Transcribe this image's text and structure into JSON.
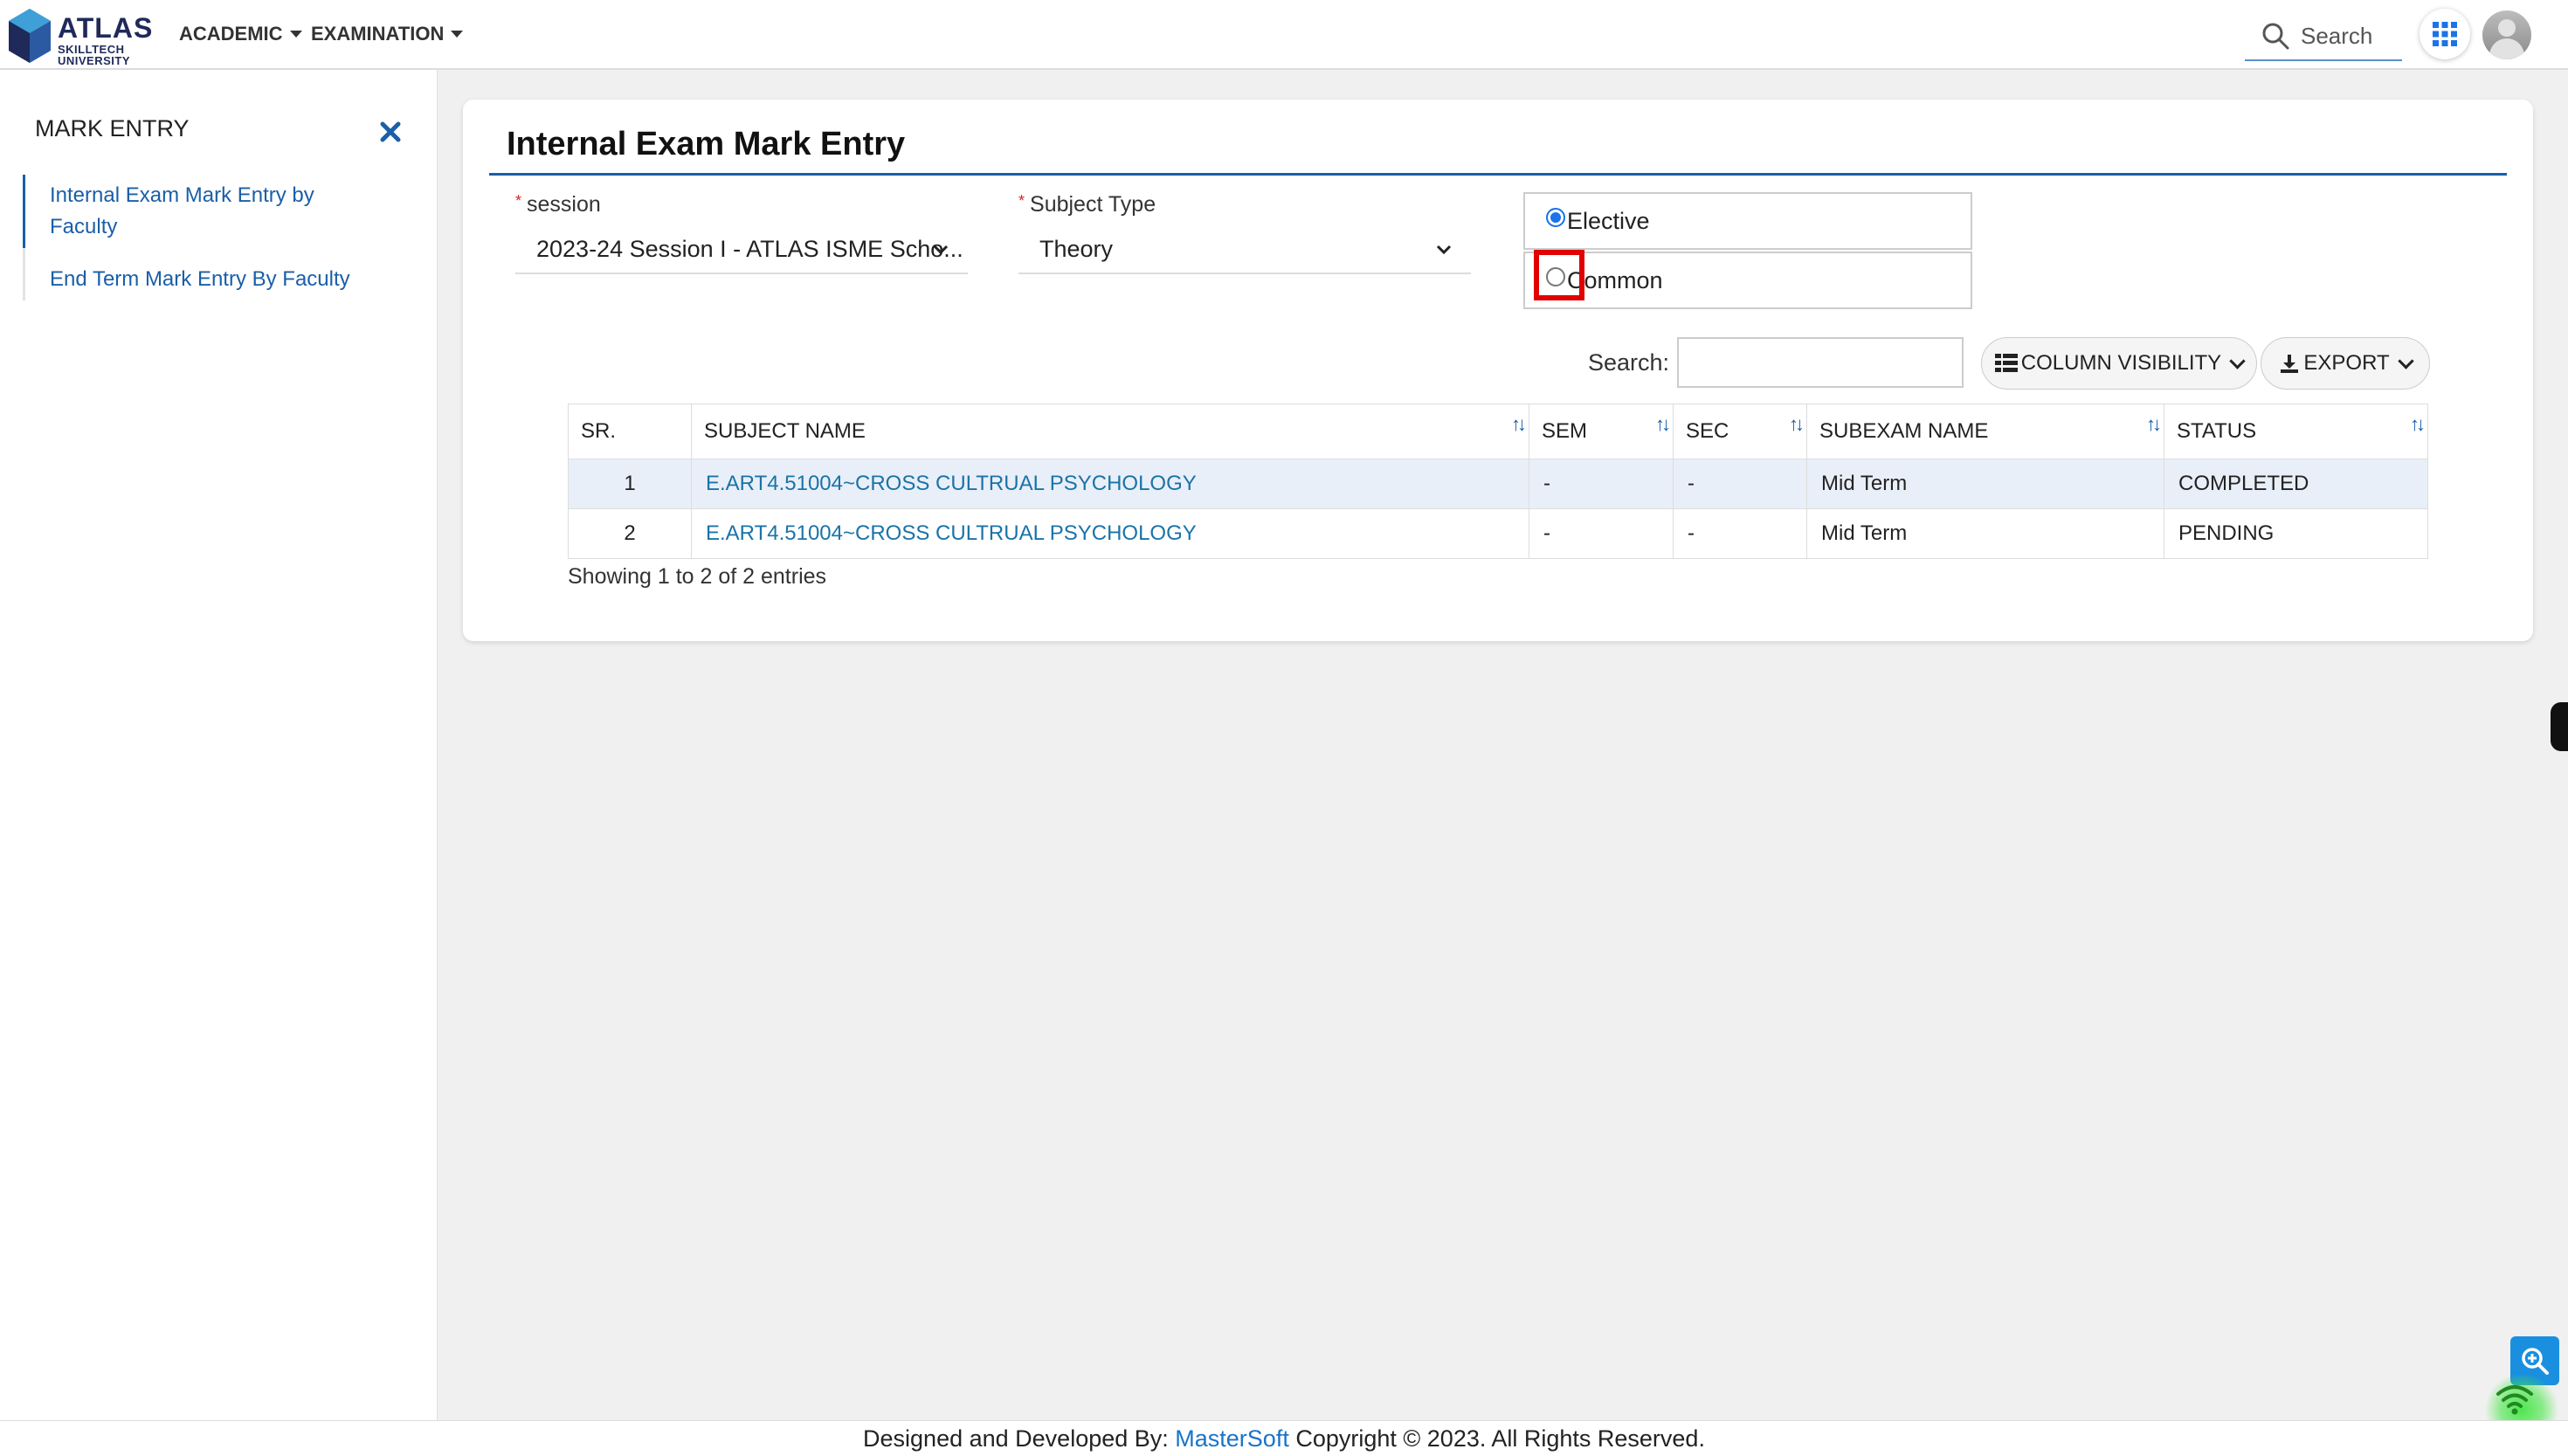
{
  "brand": {
    "name": "ATLAS",
    "subtitle_line1": "SKILLTECH",
    "subtitle_line2": "UNIVERSITY"
  },
  "nav": {
    "menus": [
      {
        "label": "ACADEMIC"
      },
      {
        "label": "EXAMINATION"
      }
    ]
  },
  "header": {
    "search_placeholder": "Search"
  },
  "sidebar": {
    "title": "MARK ENTRY",
    "items": [
      {
        "label": "Internal Exam Mark Entry by",
        "label2": "Faculty",
        "active": true
      },
      {
        "label": "End Term Mark Entry By Faculty",
        "active": false
      }
    ]
  },
  "page": {
    "title": "Internal Exam Mark Entry",
    "session": {
      "label": "session",
      "value": "2023-24 Session I - ATLAS ISME Scho..."
    },
    "subject_type": {
      "label": "Subject Type",
      "value": "Theory"
    },
    "radios": [
      {
        "label": "Elective",
        "checked": true
      },
      {
        "label": "Common",
        "checked": false
      }
    ]
  },
  "table": {
    "search_label": "Search:",
    "column_visibility_label": "COLUMN VISIBILITY",
    "export_label": "EXPORT",
    "columns": [
      "SR.",
      "SUBJECT NAME",
      "SEM",
      "SEC",
      "SUBEXAM NAME",
      "STATUS"
    ],
    "rows": [
      {
        "sr": "1",
        "subject": "E.ART4.51004~CROSS CULTRUAL PSYCHOLOGY",
        "sem": "-",
        "sec": "-",
        "subexam": "Mid Term",
        "status": "COMPLETED"
      },
      {
        "sr": "2",
        "subject": "E.ART4.51004~CROSS CULTRUAL PSYCHOLOGY",
        "sem": "-",
        "sec": "-",
        "subexam": "Mid Term",
        "status": "PENDING"
      }
    ],
    "info": "Showing 1 to 2 of 2 entries"
  },
  "footer": {
    "prefix": "Designed and Developed By: ",
    "brand": "MasterSoft",
    "suffix": " Copyright © 2023. All Rights Reserved."
  },
  "colors": {
    "accent": "#1a5fa8",
    "link": "#1a73a8",
    "highlight": "#e00000",
    "row_stripe": "#e9eff8"
  },
  "icons": [
    "search-icon",
    "apps-grid-icon",
    "close-icon",
    "chevron-down-icon",
    "sort-icon",
    "table-icon",
    "download-icon",
    "zoom-icon",
    "wifi-icon"
  ]
}
